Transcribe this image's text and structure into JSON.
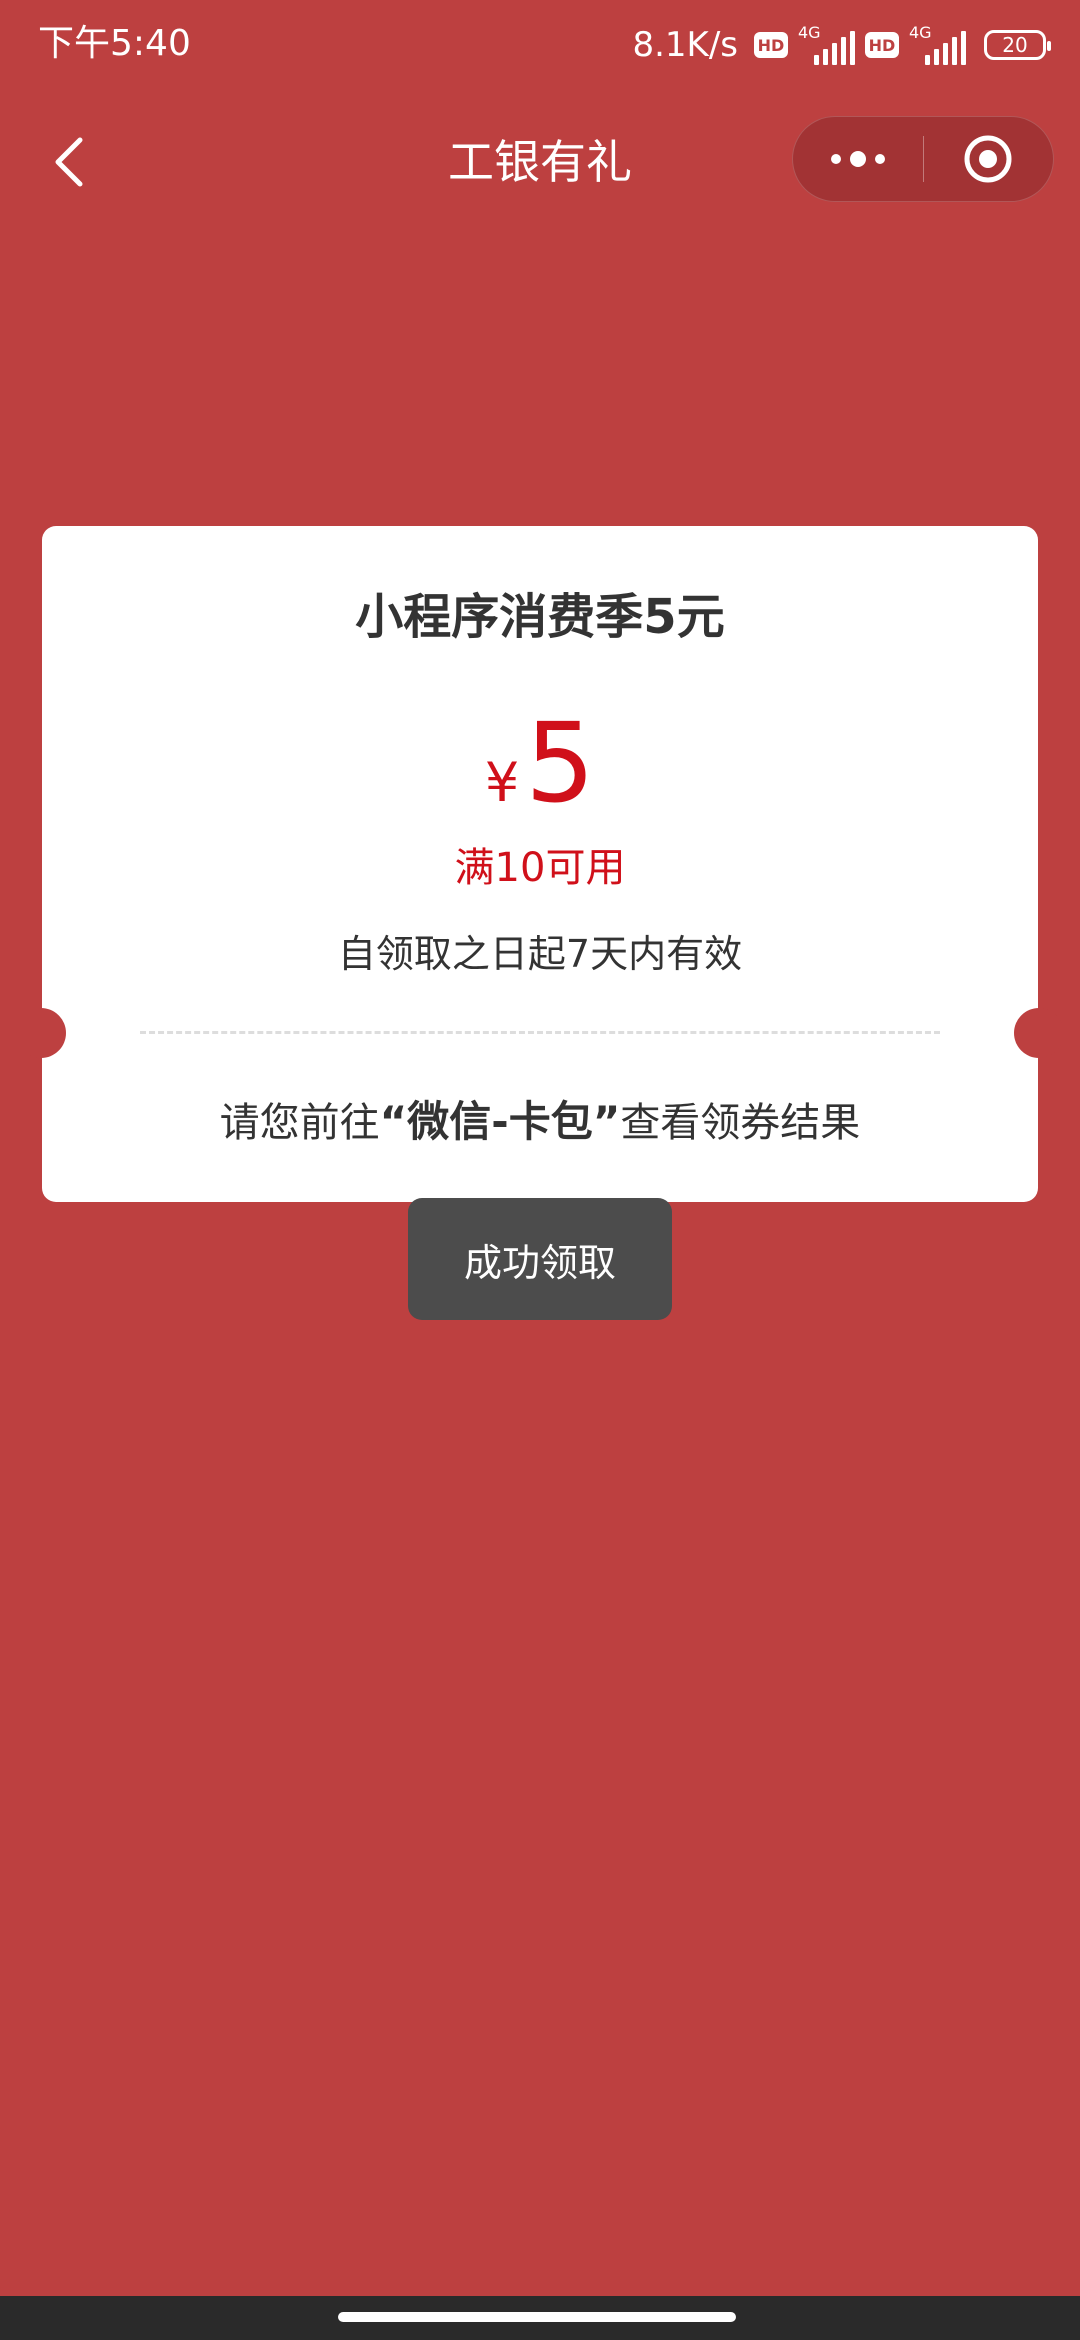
{
  "status_bar": {
    "time": "下午5:40",
    "net_speed": "8.1K/s",
    "hd_label": "HD",
    "network_type": "4G",
    "battery": "20"
  },
  "nav": {
    "title": "工银有礼",
    "back_icon": "chevron-left-icon",
    "more_icon": "more-dots-icon",
    "close_icon": "target-close-icon"
  },
  "coupon": {
    "title": "小程序消费季5元",
    "currency": "¥",
    "amount": "5",
    "threshold": "满10可用",
    "validity": "自领取之日起7天内有效",
    "instruction_before": "请您前往",
    "instruction_highlight": "“微信-卡包”",
    "instruction_after": "查看领券结果"
  },
  "toast": {
    "text": "成功领取"
  },
  "colors": {
    "background": "#bd4040",
    "accent_red": "#d0101a",
    "toast_bg": "#4c4c4c"
  }
}
